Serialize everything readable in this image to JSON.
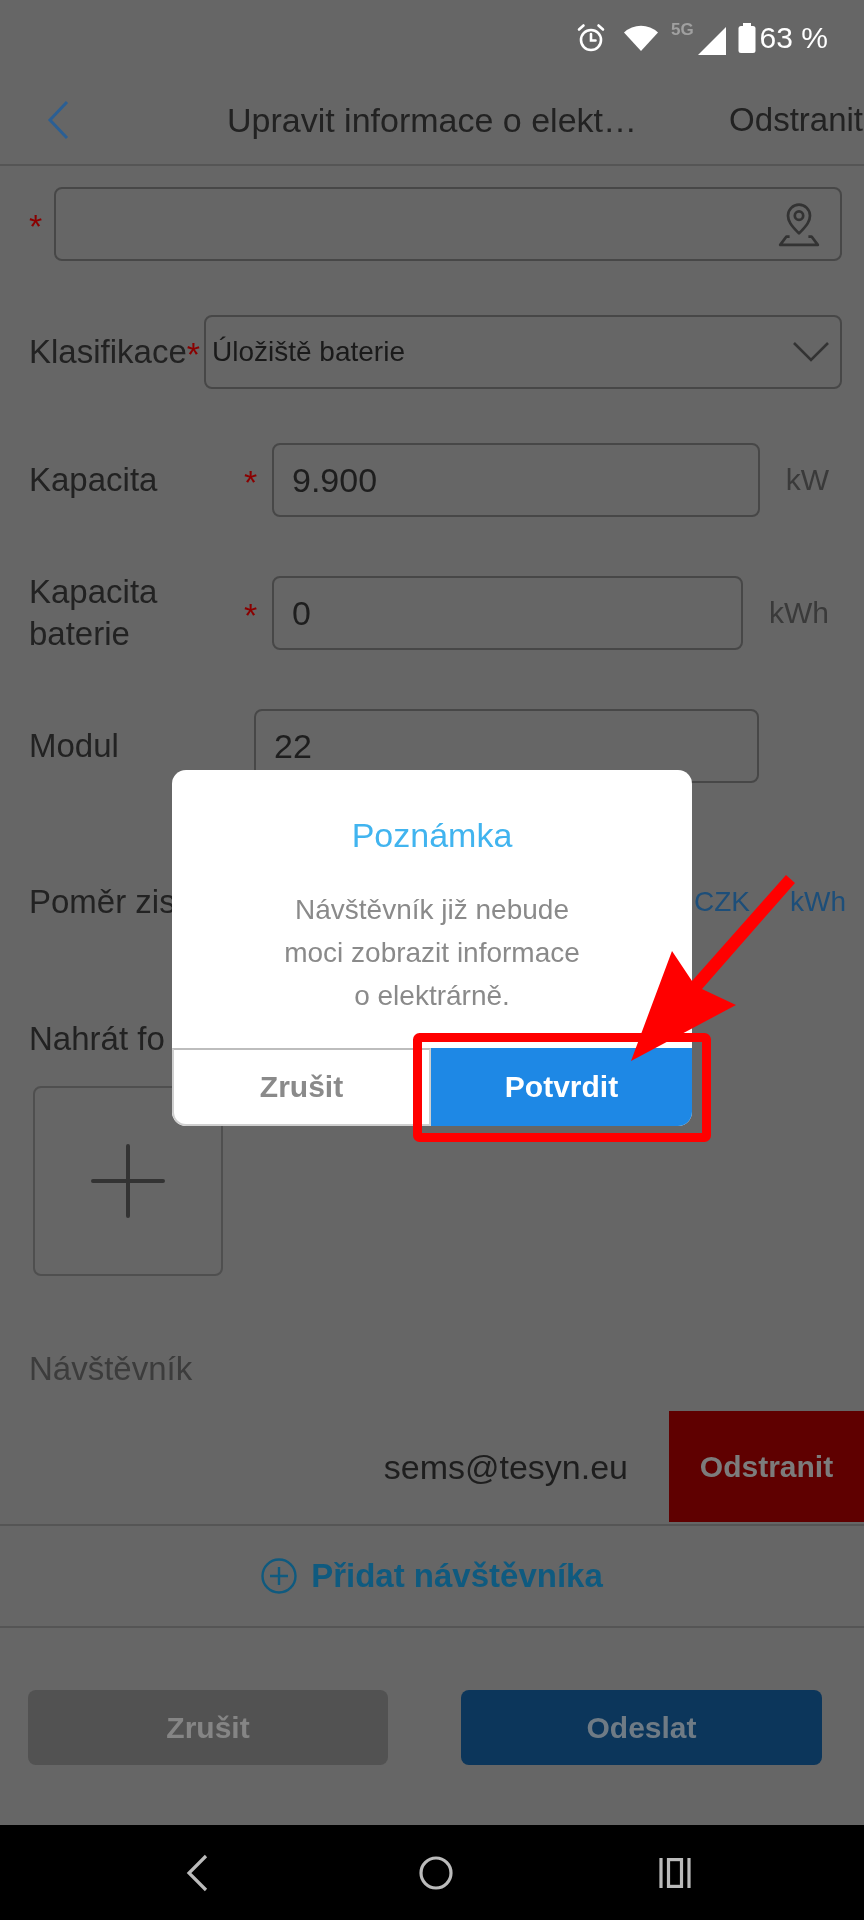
{
  "status_bar": {
    "network": "5G",
    "battery": "63 %"
  },
  "header": {
    "title": "Upravit informace o elekt…",
    "action": "Odstranit"
  },
  "form": [
    {
      "kind": "location",
      "mark": "*"
    },
    {
      "kind": "select",
      "label": "Klasifikace",
      "mark": "*",
      "value": "Úložiště baterie"
    },
    {
      "kind": "input",
      "label": "Kapacita",
      "mark": "*",
      "value": "9.900",
      "unit": "kW"
    },
    {
      "kind": "input",
      "label": "Kapacita baterie",
      "mark": "*",
      "value": "0",
      "unit": "kWh"
    },
    {
      "kind": "input",
      "label": "Modul",
      "value": "22"
    },
    {
      "kind": "ratio",
      "label": "Poměr zis",
      "unit_parts": [
        "CZK",
        "kWh"
      ]
    },
    {
      "kind": "upload",
      "label": "Nahrát fo"
    }
  ],
  "visitors": {
    "label": "Návštěvník",
    "items": [
      {
        "email": "sems@tesyn.eu",
        "action": "Odstranit"
      }
    ],
    "add": "Přidat návštěvníka"
  },
  "footer_buttons": [
    {
      "kind": "secondary",
      "label": "Zrušit"
    },
    {
      "kind": "primary",
      "label": "Odeslat"
    }
  ],
  "dialog": {
    "title": "Poznámka",
    "message": "Návštěvník již nebude moci zobrazit informace o elektrárně.",
    "buttons": [
      {
        "kind": "cancel",
        "label": "Zrušit",
        "annotated": false
      },
      {
        "kind": "confirm",
        "label": "Potvrdit",
        "annotated": true
      }
    ]
  }
}
